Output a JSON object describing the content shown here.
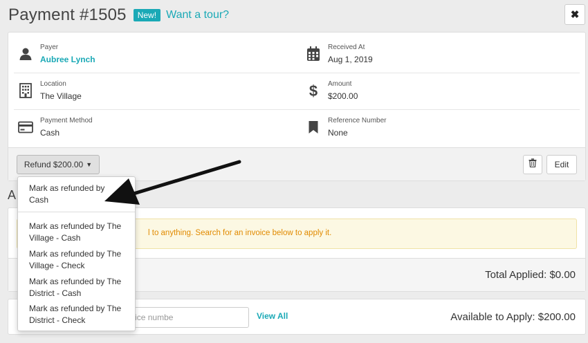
{
  "header": {
    "title": "Payment #1505",
    "badge": "New!",
    "tour_link": "Want a tour?",
    "close_label": "✖"
  },
  "details": {
    "payer": {
      "label": "Payer",
      "value": "Aubree Lynch",
      "icon": "user-icon"
    },
    "received_at": {
      "label": "Received At",
      "value": "Aug 1, 2019",
      "icon": "calendar-icon"
    },
    "location": {
      "label": "Location",
      "value": "The Village",
      "icon": "building-icon"
    },
    "amount": {
      "label": "Amount",
      "value": "$200.00",
      "icon": "dollar-icon"
    },
    "payment_method": {
      "label": "Payment Method",
      "value": "Cash",
      "icon": "credit-card-icon"
    },
    "reference_number": {
      "label": "Reference Number",
      "value": "None",
      "icon": "bookmark-icon"
    }
  },
  "actions": {
    "refund_label": "Refund $200.00",
    "edit_label": "Edit"
  },
  "refund_menu": {
    "items": [
      "Mark as refunded by Cash",
      "Mark as refunded by The Village - Cash",
      "Mark as refunded by The Village - Check",
      "Mark as refunded by The District - Cash",
      "Mark as refunded by The District - Check"
    ]
  },
  "applied_section": {
    "heading_visible": "A",
    "warning_visible_text": "l to anything. Search for an invoice below to apply it.",
    "total_applied": "Total Applied: $0.00"
  },
  "apply_section": {
    "search_placeholder": "y patient, invoice numbe",
    "view_all": "View All",
    "available": "Available to Apply: $200.00"
  },
  "colors": {
    "accent": "#1aa9b6",
    "warning_text": "#e18a00",
    "warning_bg": "#fcf8e3"
  }
}
